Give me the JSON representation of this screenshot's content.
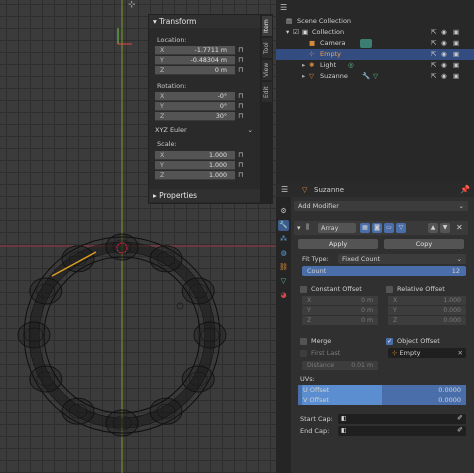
{
  "viewport": {
    "gizmo_icon": "move-gizmo-icon"
  },
  "npanel": {
    "title": "Transform",
    "location": {
      "label": "Location:",
      "x_axis": "X",
      "x": "-1.7711 m",
      "y_axis": "Y",
      "y": "-0.48304 m",
      "z_axis": "Z",
      "z": "0 m"
    },
    "rotation": {
      "label": "Rotation:",
      "x_axis": "X",
      "x": "-0°",
      "y_axis": "Y",
      "y": "0°",
      "z_axis": "Z",
      "z": "30°",
      "mode": "XYZ Euler"
    },
    "scale": {
      "label": "Scale:",
      "x_axis": "X",
      "x": "1.000",
      "y_axis": "Y",
      "y": "1.000",
      "z_axis": "Z",
      "z": "1.000"
    },
    "properties": "Properties",
    "tabs": [
      "Item",
      "Tool",
      "View",
      "Edit"
    ]
  },
  "outliner": {
    "scene": "Scene Collection",
    "collection": "Collection",
    "items": [
      "Camera",
      "Empty",
      "Light",
      "Suzanne"
    ]
  },
  "properties": {
    "object": "Suzanne",
    "add_modifier": "Add Modifier",
    "modifier_name": "Array",
    "apply": "Apply",
    "copy": "Copy",
    "fit_type_label": "Fit Type:",
    "fit_type": "Fixed Count",
    "count_label": "Count",
    "count": "12",
    "constant_offset": "Constant Offset",
    "relative_offset": "Relative Offset",
    "co": [
      {
        "k": "X",
        "v": "0 m"
      },
      {
        "k": "Y",
        "v": "0 m"
      },
      {
        "k": "Z",
        "v": "0 m"
      }
    ],
    "ro": [
      {
        "k": "X",
        "v": "1.000"
      },
      {
        "k": "Y",
        "v": "0.000"
      },
      {
        "k": "Z",
        "v": "0.000"
      }
    ],
    "merge": "Merge",
    "first_last": "First Last",
    "distance_label": "Distance",
    "distance": "0.01 m",
    "object_offset": "Object Offset",
    "offset_object": "Empty",
    "uvs_label": "UVs:",
    "u_offset_label": "U Offset",
    "u_offset": "0.0000",
    "v_offset_label": "V Offset",
    "v_offset": "0.0000",
    "start_cap": "Start Cap:",
    "end_cap": "End Cap:"
  }
}
